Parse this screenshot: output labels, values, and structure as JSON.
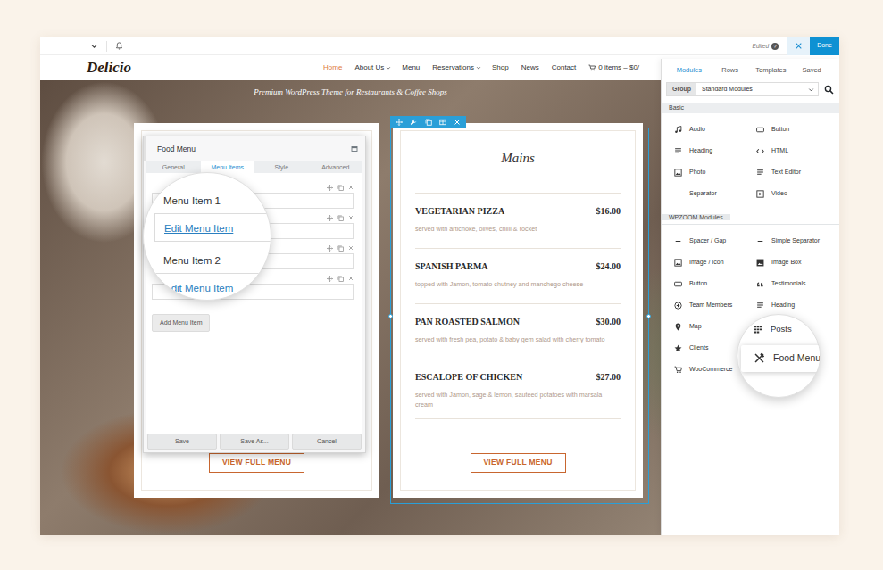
{
  "toolbar": {
    "status": "Edited",
    "help": "?",
    "done": "Done"
  },
  "site": {
    "logo": "Delicio",
    "nav": [
      {
        "label": "Home",
        "selected": true,
        "has_submenu": false
      },
      {
        "label": "About Us",
        "selected": false,
        "has_submenu": true
      },
      {
        "label": "Menu",
        "selected": false,
        "has_submenu": false
      },
      {
        "label": "Reservations",
        "selected": false,
        "has_submenu": true
      },
      {
        "label": "Shop",
        "selected": false,
        "has_submenu": false
      },
      {
        "label": "News",
        "selected": false,
        "has_submenu": false
      },
      {
        "label": "Contact",
        "selected": false,
        "has_submenu": false
      }
    ],
    "cart": "0 items – $0/",
    "tagline": "Premium WordPress Theme for Restaurants & Coffee Shops"
  },
  "left_card": {
    "button": "VIEW FULL MENU"
  },
  "dialog": {
    "title": "Food Menu",
    "tabs": [
      {
        "label": "General",
        "selected": false
      },
      {
        "label": "Menu Items",
        "selected": true
      },
      {
        "label": "Style",
        "selected": false
      },
      {
        "label": "Advanced",
        "selected": false
      }
    ],
    "items": [
      {
        "label": "Menu Item 1",
        "link": "Edit Menu Item"
      },
      {
        "label": "Menu Item 2",
        "link": "Edit Menu Item"
      }
    ],
    "add_button": "Add Menu Item",
    "footer_buttons": [
      "Save",
      "Save As...",
      "Cancel"
    ]
  },
  "right_card": {
    "heading": "Mains",
    "items": [
      {
        "name": "VEGETARIAN PIZZA",
        "price": "$16.00",
        "description": "served with artichoke, olives, chilli & rocket"
      },
      {
        "name": "SPANISH PARMA",
        "price": "$24.00",
        "description": "topped with Jamon, tomato chutney and manchego cheese"
      },
      {
        "name": "PAN ROASTED SALMON",
        "price": "$30.00",
        "description": "served with fresh pea, potato & baby gem salad with cherry tomato"
      },
      {
        "name": "ESCALOPE OF CHICKEN",
        "price": "$27.00",
        "description": "served with Jamon, sage & lemon, sauteed potatoes with marsala cream"
      }
    ],
    "button": "VIEW FULL MENU"
  },
  "panel": {
    "tabs": [
      {
        "label": "Modules",
        "selected": true
      },
      {
        "label": "Rows",
        "selected": false
      },
      {
        "label": "Templates",
        "selected": false
      },
      {
        "label": "Saved",
        "selected": false
      }
    ],
    "group": {
      "label": "Group",
      "value": "Standard Modules"
    },
    "sections": [
      {
        "title": "Basic",
        "modules": [
          {
            "label": "Audio",
            "magnified": false,
            "highlighted": false
          },
          {
            "label": "Button",
            "magnified": false,
            "highlighted": false
          },
          {
            "label": "Heading",
            "magnified": false,
            "highlighted": false
          },
          {
            "label": "HTML",
            "magnified": false,
            "highlighted": false
          },
          {
            "label": "Photo",
            "magnified": false,
            "highlighted": false
          },
          {
            "label": "Text Editor",
            "magnified": false,
            "highlighted": false
          },
          {
            "label": "Separator",
            "magnified": false,
            "highlighted": false
          },
          {
            "label": "Video",
            "magnified": false,
            "highlighted": false
          }
        ]
      },
      {
        "title": "WPZOOM Modules",
        "modules": [
          {
            "label": "Spacer / Gap",
            "magnified": false,
            "highlighted": false
          },
          {
            "label": "Simple Separator",
            "magnified": false,
            "highlighted": false
          },
          {
            "label": "Image / Icon",
            "magnified": false,
            "highlighted": false
          },
          {
            "label": "Image Box",
            "magnified": false,
            "highlighted": false
          },
          {
            "label": "Button",
            "magnified": false,
            "highlighted": false
          },
          {
            "label": "Testimonials",
            "magnified": false,
            "highlighted": false
          },
          {
            "label": "Team Members",
            "magnified": false,
            "highlighted": false
          },
          {
            "label": "Heading",
            "magnified": false,
            "highlighted": false
          },
          {
            "label": "Map",
            "magnified": false,
            "highlighted": false
          },
          {
            "label": "Posts",
            "magnified": true,
            "highlighted": false
          },
          {
            "label": "Clients",
            "magnified": false,
            "highlighted": false
          },
          {
            "label": "Food Menu",
            "magnified": true,
            "highlighted": true
          },
          {
            "label": "WooCommerce",
            "magnified": false,
            "highlighted": false
          }
        ]
      }
    ]
  }
}
